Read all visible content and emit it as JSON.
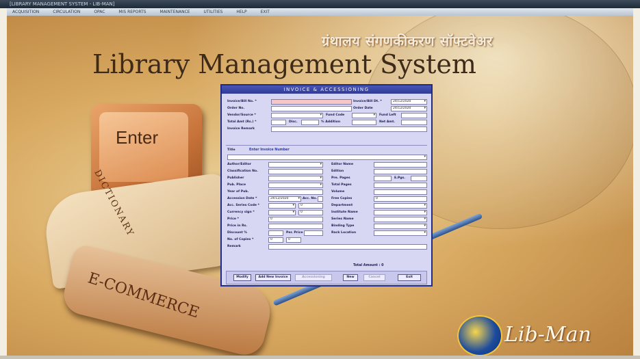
{
  "window": {
    "titlebar_text": "[LIBRARY MANAGEMENT SYSTEM - LIB-MAN]",
    "menu": [
      "ACQUISITION",
      "CIRCULATION",
      "OPAC",
      "MIS REPORTS",
      "MAINTENANCE",
      "UTILITIES",
      "HELP",
      "EXIT"
    ]
  },
  "background": {
    "hindi_title": "ग्रंथालय संगणकीकरण सॉफ्टवेअर",
    "main_title": "Library Management System",
    "enter_key": "Enter",
    "dictionary_text": "DICTIONARY",
    "ecommerce_text": "E-COMMERCE",
    "logo_text": "Lib-Man"
  },
  "dialog": {
    "title": "INVOICE & ACCESSIONING",
    "invoice_no_label": "Invoice/Bill No. *",
    "invoice_dt_label": "Invoice/Bill Dt. *",
    "invoice_dt_value": "24/12/2020",
    "order_no_label": "Order No.",
    "order_date_label": "Order Date",
    "order_date_value": "24/12/2020",
    "vendor_label": "Vendor/Source *",
    "fund_code_label": "Fund Code",
    "fund_left_label": "Fund Left",
    "total_amt_label": "Total Amt (Rs.) *",
    "disc_label": "Disc.",
    "pct_addition_label": "% Addition",
    "net_amt_label": "Net Amt.",
    "invoice_remark_label": "Invoice Remark",
    "title_label": "Title",
    "title_hint": "Enter Invoice Number",
    "left_fields": [
      {
        "label": "Author/Editor",
        "value": ""
      },
      {
        "label": "Classification No.",
        "value": ""
      },
      {
        "label": "Publisher",
        "value": ""
      },
      {
        "label": "Pub. Place",
        "value": ""
      },
      {
        "label": "Year of Pub.",
        "value": ""
      }
    ],
    "right_fields": [
      {
        "label": "Editor Name",
        "value": ""
      },
      {
        "label": "Edition",
        "value": ""
      },
      {
        "label": "Pre. Pages",
        "value": ""
      },
      {
        "label": "Total Pages",
        "value": ""
      },
      {
        "label": "Volume",
        "value": ""
      },
      {
        "label": "Free Copies",
        "value": "0"
      },
      {
        "label": "Department",
        "value": ""
      },
      {
        "label": "Institute Name",
        "value": ""
      },
      {
        "label": "Series Name",
        "value": ""
      },
      {
        "label": "Binding Type",
        "value": ""
      },
      {
        "label": "Rack Location",
        "value": ""
      }
    ],
    "epgs_label": "E.Pgs.",
    "accession_date_label": "Accession Date *",
    "accession_date_value": "24/12/2020",
    "acc_no_label": "Acc. No.",
    "acc_series_label": "Acc. Series Code *",
    "acc_series_value": "0",
    "currency_label": "Currency sign *",
    "currency_value": "0",
    "price_label": "Price *",
    "price_value": "0",
    "price_rs_label": "Price in Rs.",
    "discount_label": "Discount %",
    "per_price_label": "Per. Price",
    "no_copies_label": "No. of Copies *",
    "no_copies_value": "0",
    "no_copies_value2": "0",
    "remark_label": "Remark",
    "total_amount": "Total Amount : 0",
    "buttons": {
      "modify": "Modify",
      "add_new_invoice": "Add New Invoice",
      "accessioning": "Accessioning",
      "new": "New",
      "cancel": "Cancel",
      "exit": "Exit"
    }
  }
}
